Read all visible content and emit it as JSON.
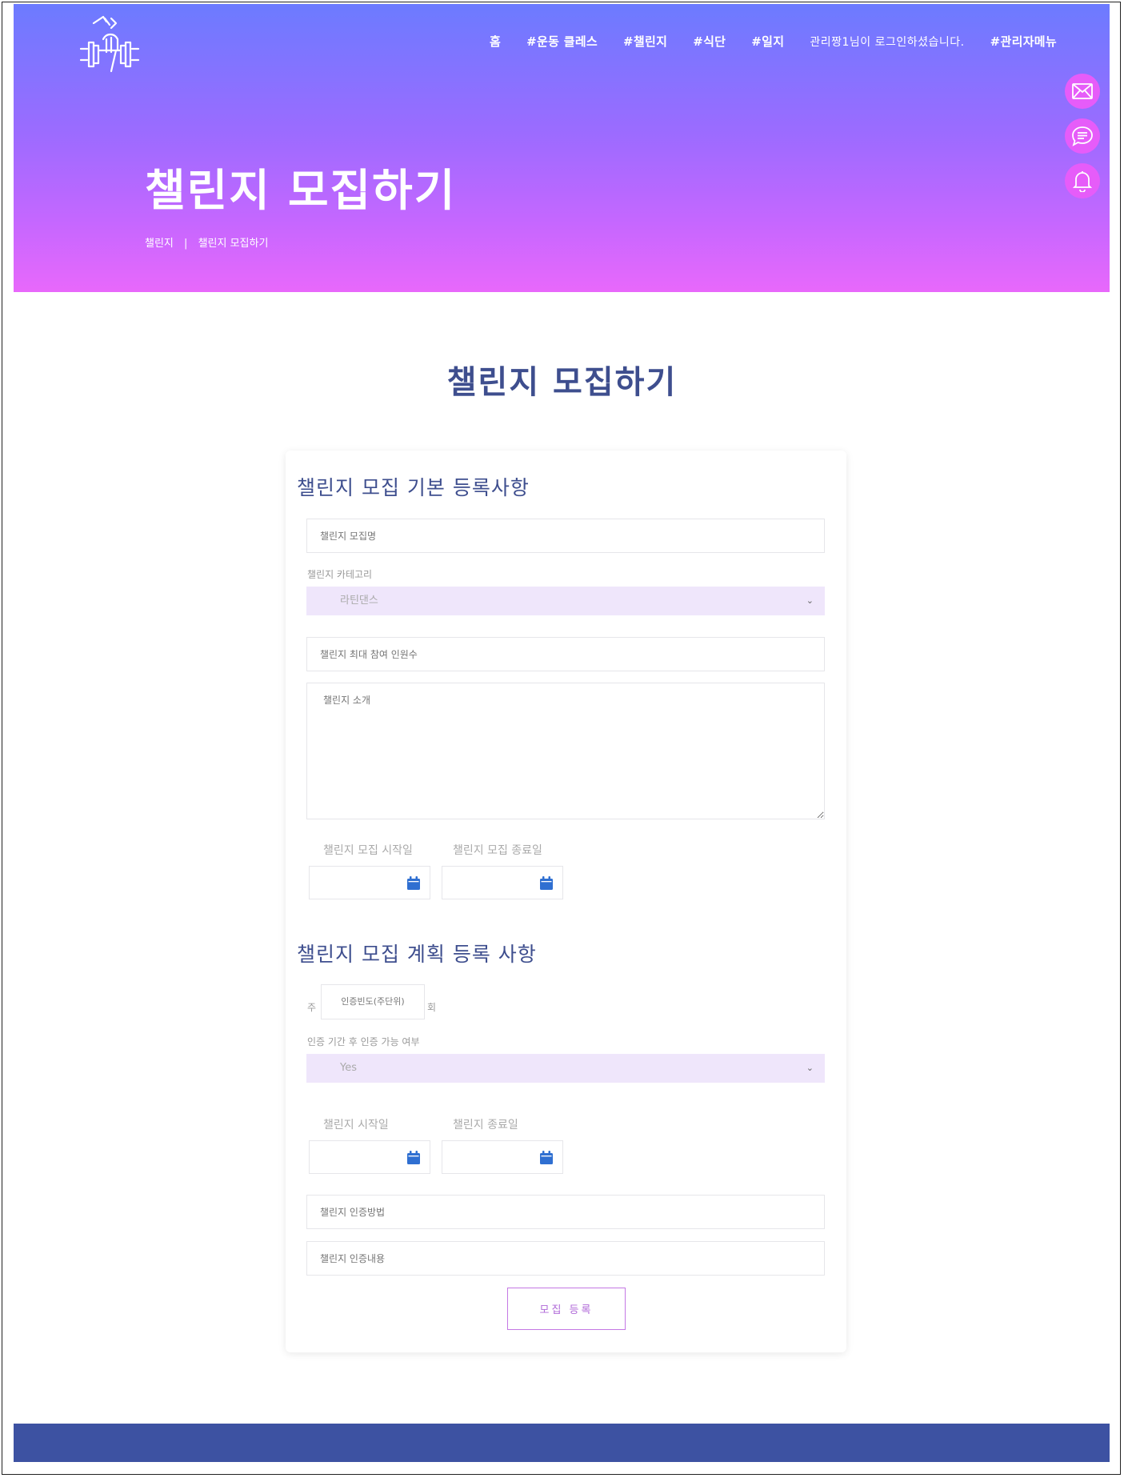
{
  "header": {
    "nav": [
      {
        "label": "홈"
      },
      {
        "label": "#운동 클레스"
      },
      {
        "label": "#챌린지"
      },
      {
        "label": "#식단"
      },
      {
        "label": "#일지"
      }
    ],
    "login_text": "관리짱1님이 로그인하셨습니다.",
    "admin_menu": "#관리자메뉴",
    "side_icons": [
      "mail-icon",
      "chat-icon",
      "bell-icon"
    ],
    "hero_title": "챌린지 모집하기",
    "breadcrumb": {
      "parent": "챌린지",
      "separator": "|",
      "current": "챌린지 모집하기"
    }
  },
  "main": {
    "title": "챌린지 모집하기",
    "section1": {
      "title": "챌린지 모집 기본 등록사항",
      "name_placeholder": "챌린지 모집명",
      "category_label": "챌린지 카테고리",
      "category_value": "라틴댄스",
      "max_participants_placeholder": "챌린지 최대 참여 인원수",
      "intro_placeholder": "챌린지 소개",
      "recruit_start_label": "챌린지 모집 시작일",
      "recruit_end_label": "챌린지 모집 종료일"
    },
    "section2": {
      "title": "챌린지 모집 계획 등록 사항",
      "freq_prefix": "주",
      "freq_placeholder": "인증빈도(주단위)",
      "freq_suffix": "회",
      "late_auth_label": "인증 기간 후 인증 가능 여부",
      "late_auth_value": "Yes",
      "start_label": "챌린지 시작일",
      "end_label": "챌린지 종료일",
      "auth_method_placeholder": "챌린지 인증방법",
      "auth_content_placeholder": "챌린지 인증내용"
    },
    "submit_label": "모집 등록"
  },
  "colors": {
    "hero_top": "#6c7bff",
    "hero_bottom": "#e868fb",
    "title": "#3e4e8e",
    "select_bg": "#efe6fb",
    "calendar": "#2f6fd1",
    "footer": "#3d52a2",
    "submit_border": "#c478e4"
  }
}
